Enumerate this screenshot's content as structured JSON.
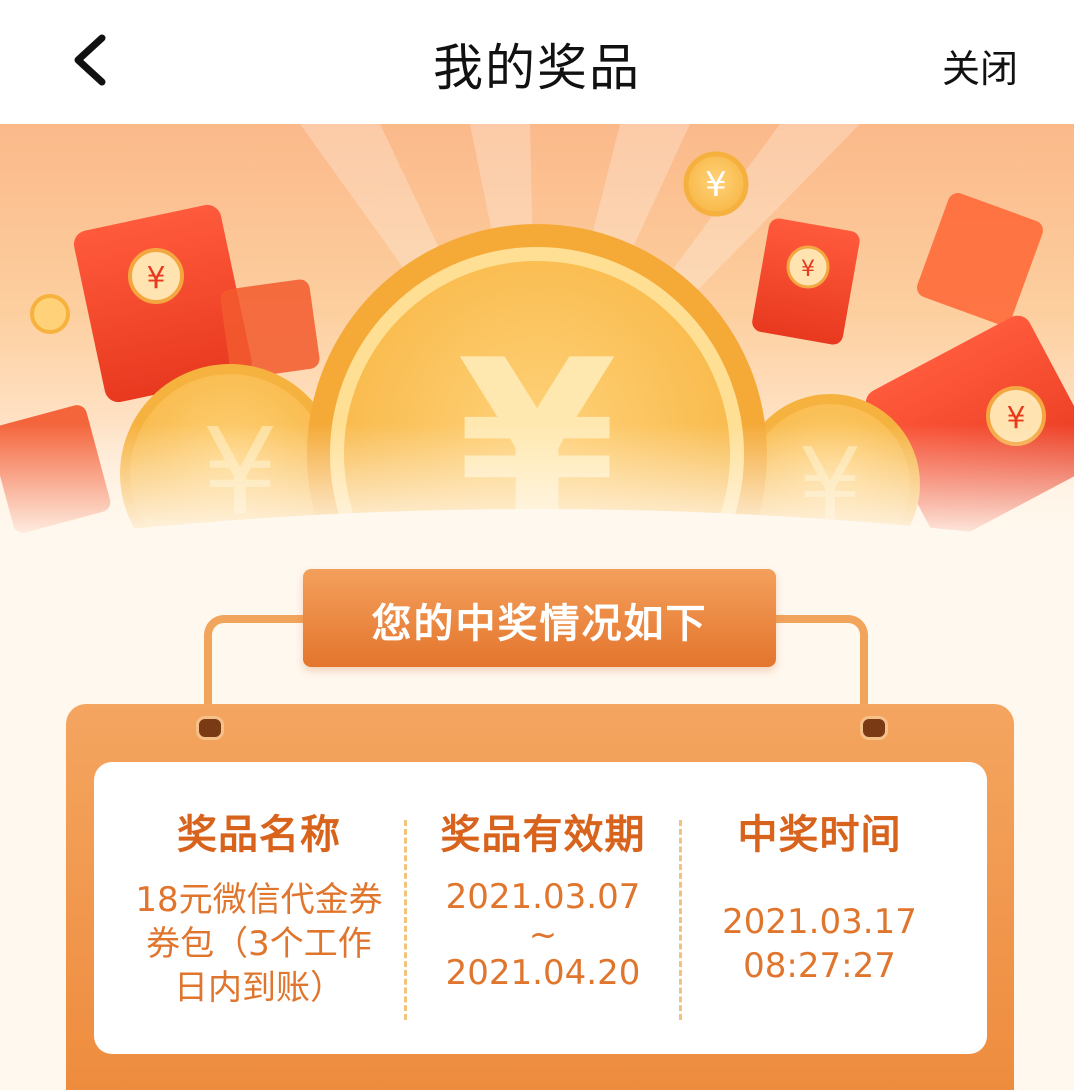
{
  "nav": {
    "title": "我的奖品",
    "close_label": "关闭"
  },
  "banner": {
    "coin_icon": "yuan-coin-icon",
    "packet_icon": "red-envelope-icon"
  },
  "heading": "您的中奖情况如下",
  "table": {
    "columns": [
      {
        "header": "奖品名称",
        "lines": [
          "18元微信代金券",
          "券包（3个工作",
          "日内到账）"
        ]
      },
      {
        "header": "奖品有效期",
        "lines": [
          "2021.03.07",
          "~",
          "2021.04.20"
        ]
      },
      {
        "header": "中奖时间",
        "lines": [
          "2021.03.17",
          "08:27:27"
        ]
      }
    ]
  },
  "colors": {
    "accent": "#e4752d",
    "text_orange": "#e0762e",
    "header_orange": "#d7631c"
  }
}
